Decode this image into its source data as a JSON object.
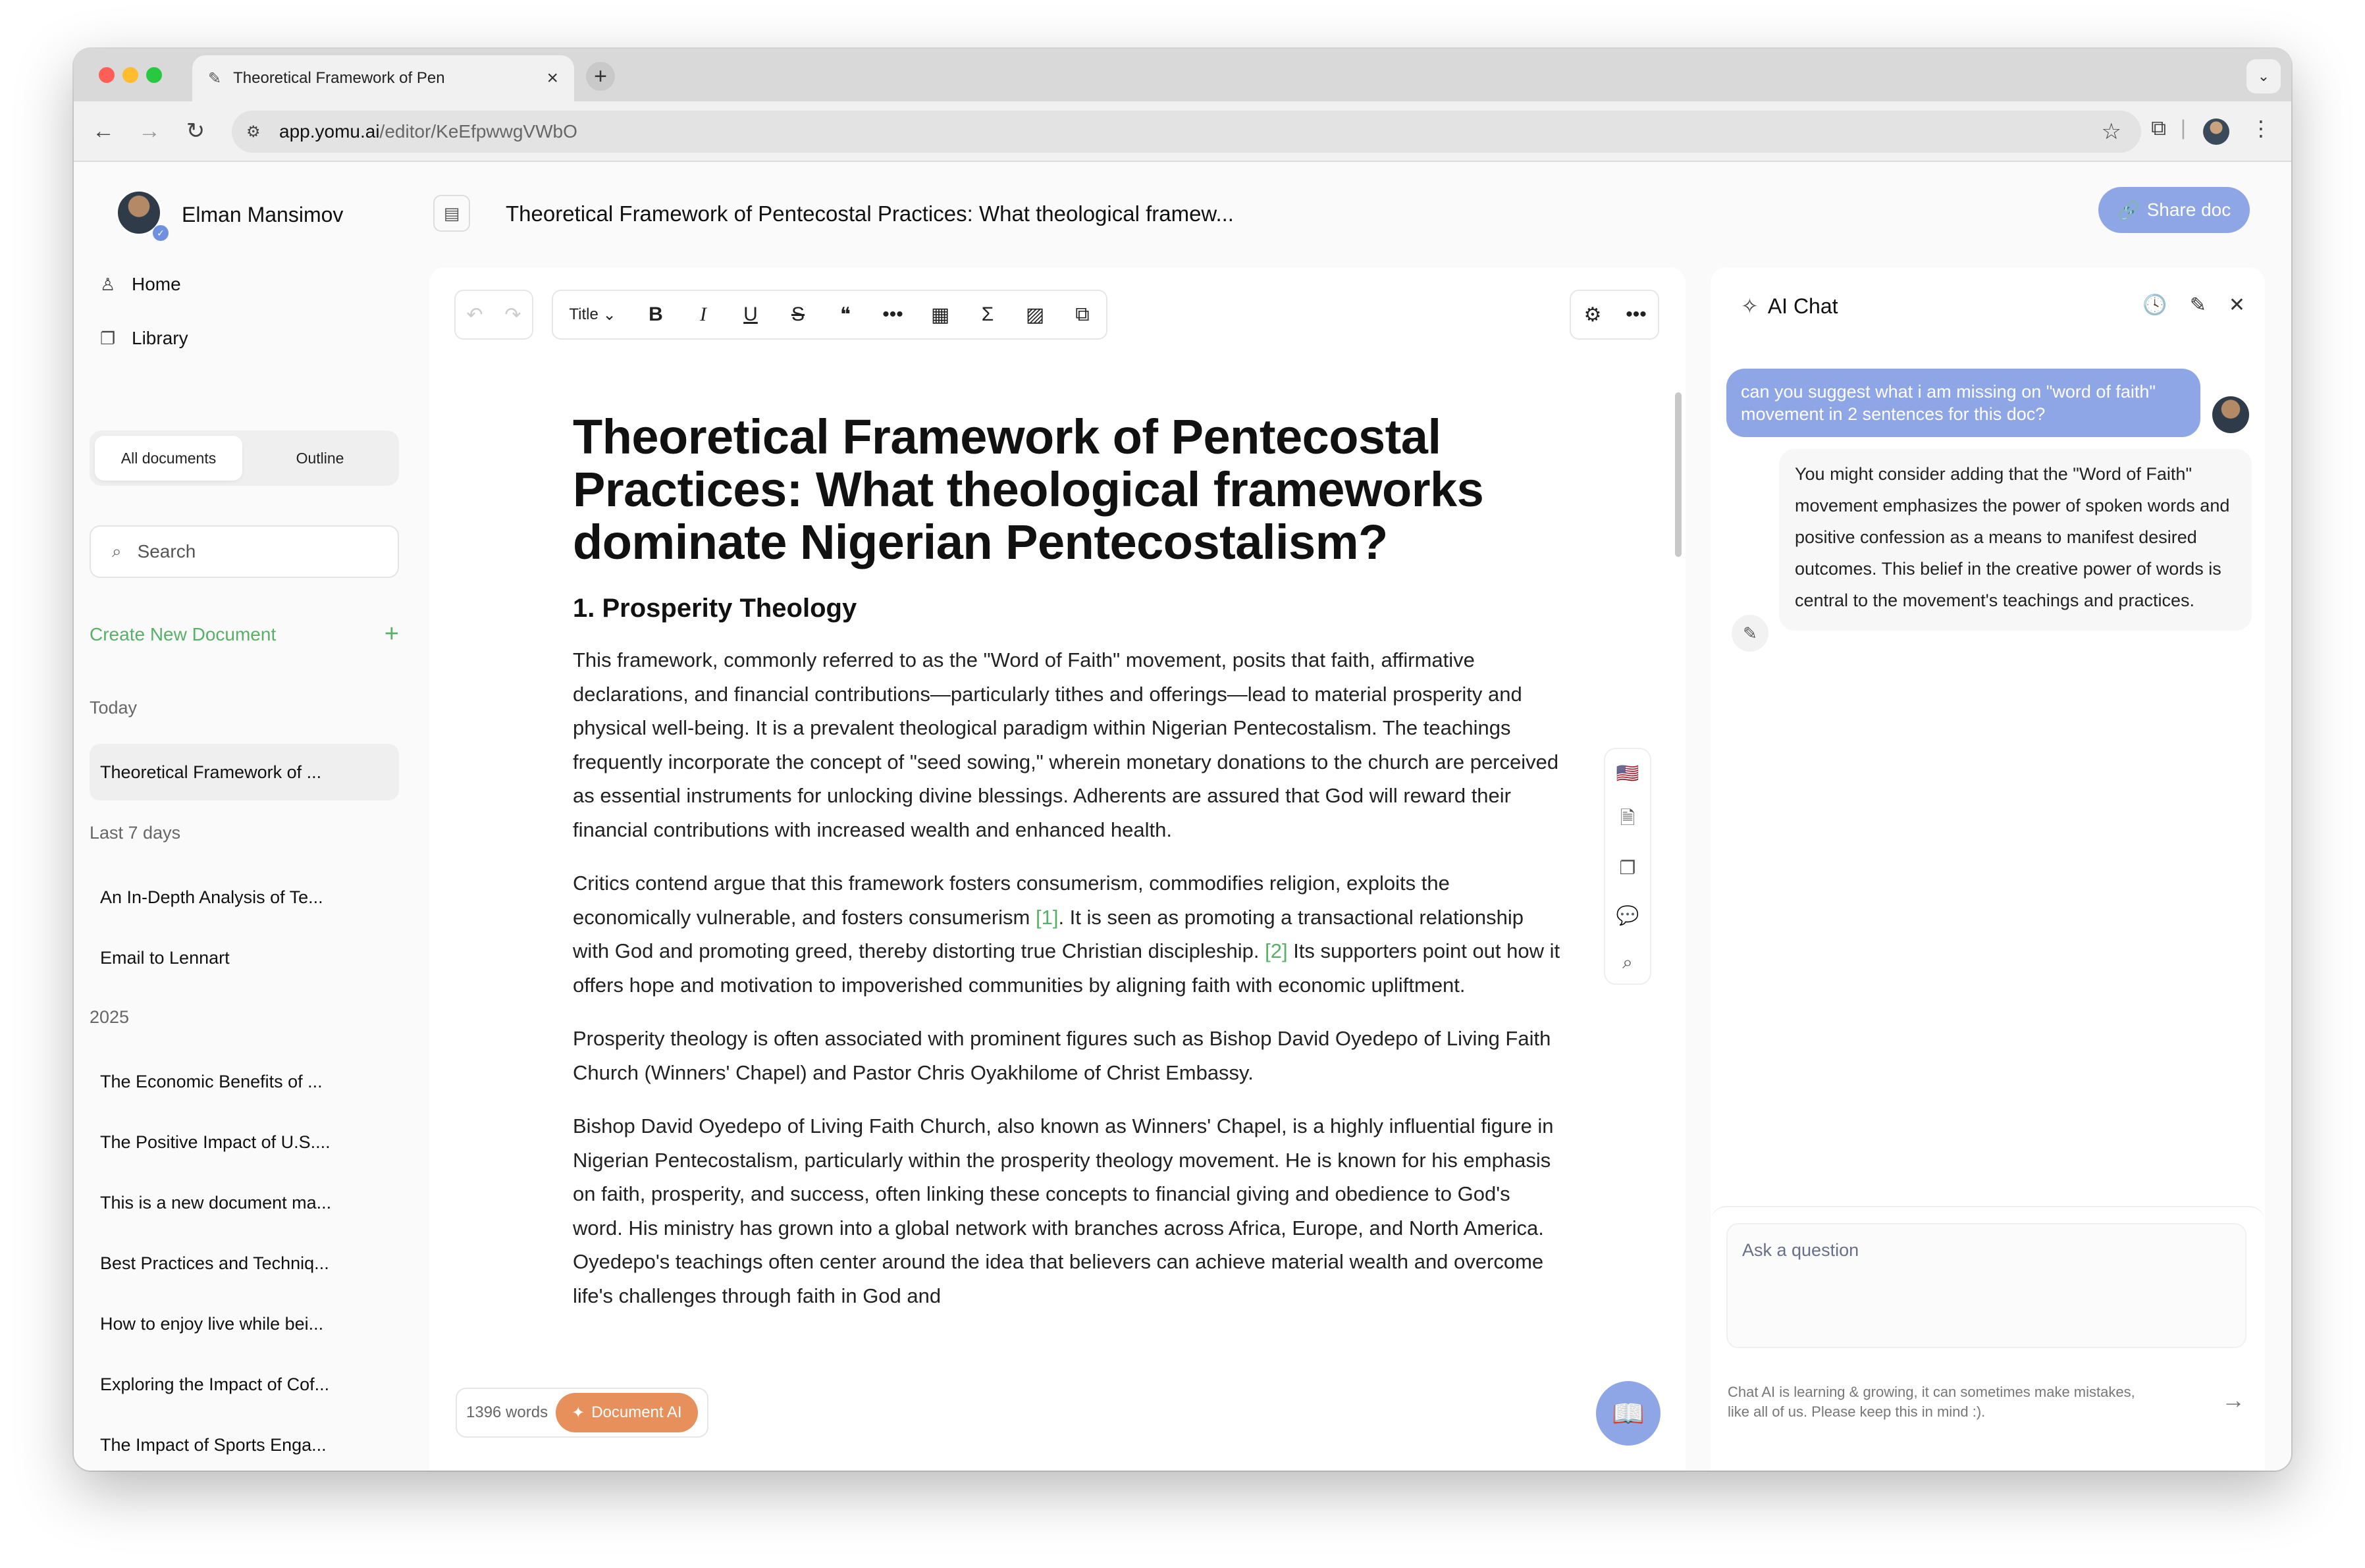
{
  "browser": {
    "tab_title": "Theoretical Framework of Pen",
    "url_host": "app.yomu.ai",
    "url_path": "/editor/KeEfpwwgVWbO",
    "colors": {
      "close": "#ff5f57",
      "minimize": "#febc2e",
      "maximize": "#28c840"
    }
  },
  "sidebar": {
    "user_name": "Elman Mansimov",
    "nav": [
      {
        "label": "Home",
        "icon": "user-icon"
      },
      {
        "label": "Library",
        "icon": "library-icon"
      }
    ],
    "tabs": [
      "All documents",
      "Outline"
    ],
    "search_placeholder": "Search",
    "create_label": "Create New Document",
    "sections": {
      "today": "Today",
      "last7": "Last 7 days",
      "year": "2025"
    },
    "today_docs": [
      "Theoretical Framework of ..."
    ],
    "last7_docs": [
      "An In-Depth Analysis of Te...",
      "Email to Lennart"
    ],
    "year_docs": [
      "The Economic Benefits of ...",
      "The Positive Impact of U.S....",
      "This is a new document ma...",
      "Best Practices and Techniq...",
      "How to enjoy live while bei...",
      "Exploring the Impact of Cof...",
      "The Impact of Sports Enga..."
    ]
  },
  "header": {
    "doc_title": "Theoretical Framework of Pentecostal Practices: What theological framew...",
    "share_label": "Share doc"
  },
  "editor": {
    "style_select": "Title",
    "title": "Theoretical Framework of Pentecostal Practices: What theological frameworks dominate Nigerian Pentecostalism?",
    "heading": "1. Prosperity Theology",
    "p1": "This framework, commonly referred to as the \"Word of Faith\" movement, posits that faith, affirmative declarations, and financial contributions—particularly tithes and offerings—lead to material prosperity and physical well-being. It is a prevalent theological paradigm within Nigerian Pentecostalism. The teachings frequently incorporate the concept of \"seed sowing,\" wherein monetary donations to the church are perceived as essential instruments for unlocking divine blessings. Adherents are assured that God will reward their financial contributions with increased wealth and enhanced health.",
    "p2a": "Critics contend argue that this framework fosters consumerism, commodifies religion, exploits the economically vulnerable, and fosters consumerism ",
    "cite1": "[1]",
    "p2b": ". It is seen as promoting a transactional relationship with God and promoting greed, thereby distorting true Christian discipleship. ",
    "cite2": "[2]",
    "p2c": " Its supporters point out how it offers hope and motivation to impoverished communities by aligning faith with economic upliftment.",
    "p3": "Prosperity theology is often associated with prominent figures such as Bishop David Oyedepo of Living Faith Church (Winners' Chapel) and Pastor Chris Oyakhilome of Christ Embassy.",
    "p4": "Bishop David Oyedepo of Living Faith Church, also known as Winners' Chapel, is a highly influential figure in Nigerian Pentecostalism, particularly within the prosperity theology movement. He is known for his emphasis on faith, prosperity, and success, often linking these concepts to financial giving and obedience to God's word. His ministry has grown into a global network with branches across Africa, Europe, and North America. Oyedepo's teachings often center around the idea that believers can achieve material wealth and overcome life's challenges through faith in God and",
    "word_count": "1396 words",
    "doc_ai_label": "Document AI"
  },
  "chat": {
    "title": "AI Chat",
    "user_message": "can you suggest what i am missing on \"word of faith\" movement in 2 sentences for this doc?",
    "ai_message": "You might consider adding that the \"Word of Faith\" movement emphasizes the power of spoken words and positive confession as a means to manifest desired outcomes. This belief in the creative power of words is central to the movement's teachings and practices.",
    "input_placeholder": "Ask a question",
    "disclaimer": "Chat AI is learning & growing, it can sometimes make mistakes, like all of us. Please keep this in mind :)."
  },
  "colors": {
    "accent_blue": "#8fa6e6",
    "green": "#58b067",
    "orange": "#e7905c"
  }
}
